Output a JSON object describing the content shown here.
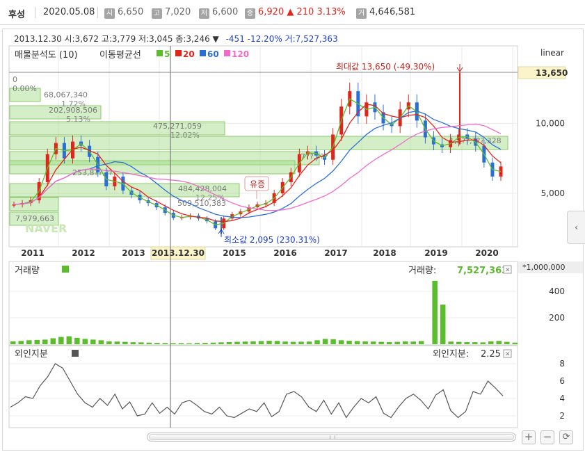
{
  "header": {
    "stock_name": "후성",
    "date": "2020.05.08",
    "open_badge": "시",
    "open": "6,650",
    "high_badge": "고",
    "high": "7,020",
    "low_badge": "저",
    "low": "6,600",
    "close_badge": "종",
    "close": "6,920",
    "change": "▲ 210",
    "change_pct": "3.13%",
    "volume_badge": "거",
    "volume": "4,646,581"
  },
  "info_line": {
    "text": "2013.12.30 시:3,672 고:3,779 저:3,045 종:3,246 ▼",
    "diff": "-451 -12.20% 거:7,527,363"
  },
  "price_panel": {
    "title": "매물분석도 (10)",
    "ma_title": "이동평균선",
    "ma_legend": [
      {
        "label": "5",
        "color": "#5bbd2b"
      },
      {
        "label": "20",
        "color": "#e0251b"
      },
      {
        "label": "60",
        "color": "#2a6fd6"
      },
      {
        "label": "120",
        "color": "#f06ac9"
      }
    ],
    "scale_label": "linear",
    "current_price_tag": "13,650",
    "max_annotation": "최대값 13,650 (-49.30%)",
    "min_annotation": "최소값 2,095 (230.31%)",
    "event_label": "유증",
    "top_zero_label": "0",
    "top_zero_pct": "0.00%",
    "watermark": "NAVER",
    "volume_profile": [
      {
        "label": "68,067,340",
        "pct": "1.72%"
      },
      {
        "label": "202,908,506",
        "pct": "5.13%"
      },
      {
        "label": "475,271,059",
        "pct": "12.02%"
      },
      {
        "label": "7,979,663",
        "pct": ""
      },
      {
        "label": "253,8??,??",
        "pct": ""
      },
      {
        "label": "484,428,004",
        "pct": "12.25%"
      },
      {
        "label": "509,510,383",
        "pct": ""
      },
      {
        "label": "7??,???",
        "pct": ""
      },
      {
        "label": "1,3??,???,328",
        "pct": ""
      }
    ]
  },
  "volume_panel": {
    "title": "거래량",
    "value_label": "거래량:",
    "value": "7,527,363",
    "unit_label": "*1,000,000",
    "legend_color": "#5bbd2b"
  },
  "foreign_panel": {
    "title": "외인지분",
    "value_label": "외인지분:",
    "value": "2.25",
    "legend_color": "#555555"
  },
  "chart_data": [
    {
      "type": "candlestick",
      "title": "매물분석도 (10)",
      "x_ticks": [
        "2011",
        "2012",
        "2013",
        "2013.12.30",
        "2015",
        "2016",
        "2017",
        "2018",
        "2019",
        "2020"
      ],
      "y_ticks": [
        5000,
        10000,
        13650
      ],
      "ylim": [
        2000,
        15000
      ],
      "scale": "linear",
      "series": [
        {
          "name": "price",
          "x": [
            "2010-10",
            "2010-12",
            "2011-02",
            "2011-04",
            "2011-06",
            "2011-08",
            "2011-10",
            "2011-12",
            "2012-02",
            "2012-04",
            "2012-06",
            "2012-08",
            "2012-10",
            "2012-12",
            "2013-02",
            "2013-04",
            "2013-06",
            "2013-08",
            "2013-10",
            "2013-12",
            "2014-02",
            "2014-04",
            "2014-06",
            "2014-08",
            "2014-10",
            "2014-12",
            "2015-02",
            "2015-04",
            "2015-06",
            "2015-08",
            "2015-10",
            "2015-12",
            "2016-02",
            "2016-04",
            "2016-06",
            "2016-08",
            "2016-10",
            "2016-12",
            "2017-02",
            "2017-04",
            "2017-06",
            "2017-08",
            "2017-10",
            "2017-12",
            "2018-02",
            "2018-04",
            "2018-06",
            "2018-08",
            "2018-10",
            "2018-12",
            "2019-02",
            "2019-04",
            "2019-06",
            "2019-08",
            "2019-10",
            "2019-12",
            "2020-02",
            "2020-04",
            "2020-05"
          ],
          "values": [
            4200,
            4300,
            4500,
            5800,
            7800,
            8600,
            7500,
            8700,
            8400,
            7600,
            6500,
            5500,
            6200,
            5200,
            4900,
            4500,
            4300,
            4000,
            3600,
            3246,
            3300,
            3400,
            3200,
            3000,
            2500,
            3200,
            3500,
            3700,
            4000,
            4200,
            4300,
            5000,
            5800,
            6500,
            7800,
            8000,
            7700,
            7400,
            9200,
            11200,
            12300,
            10500,
            11500,
            10800,
            10000,
            9800,
            11000,
            11500,
            10200,
            9000,
            8500,
            8300,
            8800,
            9200,
            8900,
            8400,
            7200,
            6200,
            6920
          ]
        },
        {
          "name": "5",
          "color": "#5bbd2b"
        },
        {
          "name": "20",
          "color": "#e0251b"
        },
        {
          "name": "60",
          "color": "#2a6fd6"
        },
        {
          "name": "120",
          "color": "#f06ac9"
        }
      ],
      "max_value": 13650,
      "min_value": 2095
    },
    {
      "type": "bar",
      "title": "거래량",
      "y_ticks": [
        200,
        400
      ],
      "ylim": [
        0,
        520
      ],
      "values": [
        22,
        25,
        30,
        32,
        35,
        45,
        55,
        60,
        48,
        40,
        35,
        30,
        22,
        20,
        18,
        15,
        14,
        12,
        10,
        9,
        8,
        8,
        7,
        9,
        10,
        12,
        14,
        16,
        18,
        20,
        22,
        24,
        26,
        25,
        20,
        18,
        19,
        20,
        30,
        40,
        38,
        30,
        26,
        24,
        22,
        20,
        18,
        16,
        18,
        22,
        20,
        24,
        480,
        300,
        20,
        18,
        16,
        15,
        14,
        22,
        25,
        18,
        12
      ]
    },
    {
      "type": "line",
      "title": "외인지분",
      "y_ticks": [
        2,
        4,
        6,
        8
      ],
      "ylim": [
        1,
        9
      ],
      "values": [
        3.0,
        3.5,
        4.2,
        4.0,
        5.5,
        6.5,
        8.0,
        7.5,
        6.0,
        4.5,
        3.5,
        3.0,
        4.0,
        3.2,
        4.5,
        2.8,
        3.6,
        2.0,
        2.2,
        3.5,
        2.3,
        3.0,
        2.2,
        3.5,
        3.8,
        3.2,
        2.5,
        2.2,
        3.0,
        2.0,
        1.8,
        2.3,
        2.8,
        2.5,
        3.5,
        1.9,
        2.5,
        4.5,
        4.8,
        4.2,
        3.0,
        2.5,
        3.8,
        2.2,
        3.5,
        1.8,
        3.0,
        4.0,
        3.5,
        4.2,
        2.3,
        1.8,
        3.0,
        4.0,
        4.5,
        3.8,
        2.8,
        4.4,
        5.0,
        2.6,
        1.8,
        2.5,
        4.8,
        4.5,
        6.0,
        5.2,
        4.3
      ]
    }
  ]
}
